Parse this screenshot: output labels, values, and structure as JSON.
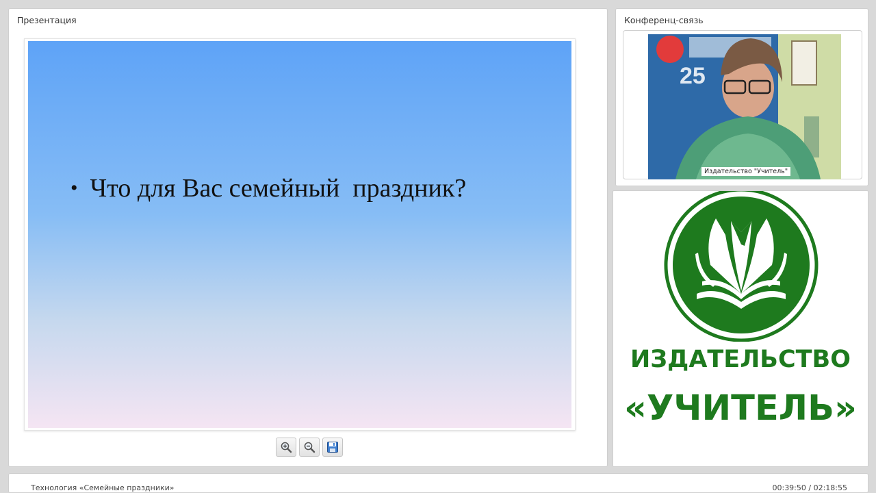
{
  "presentation": {
    "title": "Презентация",
    "slide": {
      "bullet_text": "Что для Вас семейный  праздник?"
    },
    "toolbar": {
      "zoom_in_icon": "zoom-in-icon",
      "zoom_out_icon": "zoom-out-icon",
      "save_icon": "save-icon"
    }
  },
  "conference": {
    "title": "Конференц-связь",
    "participant_label": "Издательство \"Учитель\""
  },
  "publisher_logo": {
    "line1": "ИЗДАТЕЛЬСТВО",
    "line2": "«УЧИТЕЛЬ»",
    "brand_color": "#1e7a1e"
  },
  "footer": {
    "lecture_title": "Технология «Семейные праздники»",
    "time": "00:39:50 / 02:18:55"
  }
}
